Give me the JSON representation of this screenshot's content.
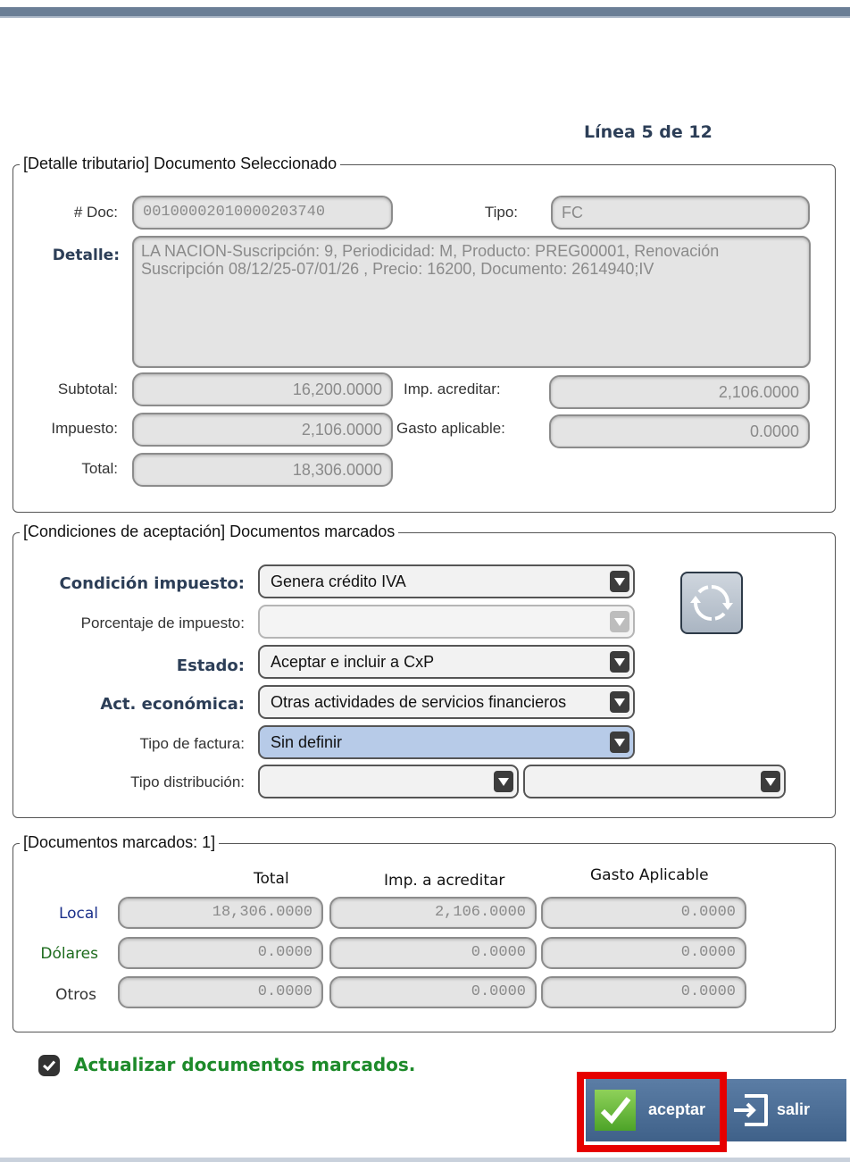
{
  "header": {
    "line_counter": "Línea 5 de 12"
  },
  "detalle_tributario": {
    "legend": "[Detalle tributario] Documento Seleccionado",
    "doc_label": "# Doc:",
    "doc_value": "00100002010000203740",
    "tipo_label": "Tipo:",
    "tipo_value": "FC",
    "detalle_label": "Detalle:",
    "detalle_value": "LA NACION-Suscripción: 9, Periodicidad: M, Producto: PREG00001, Renovación Suscripción 08/12/25-07/01/26  , Precio: 16200, Documento: 2614940;IV",
    "subtotal_label": "Subtotal:",
    "subtotal_value": "16,200.0000",
    "impuesto_label": "Impuesto:",
    "impuesto_value": "2,106.0000",
    "total_label": "Total:",
    "total_value": "18,306.0000",
    "imp_acreditar_label": "Imp. acreditar:",
    "imp_acreditar_value": "2,106.0000",
    "gasto_aplicable_label": "Gasto aplicable:",
    "gasto_aplicable_value": "0.0000"
  },
  "condiciones": {
    "legend": "[Condiciones de aceptación] Documentos marcados",
    "condicion_impuesto_label": "Condición impuesto:",
    "condicion_impuesto_value": "Genera crédito IVA",
    "porcentaje_label": "Porcentaje de impuesto:",
    "porcentaje_value": "",
    "estado_label": "Estado:",
    "estado_value": "Aceptar e incluir a CxP",
    "act_economica_label": "Act. económica:",
    "act_economica_value": "Otras actividades de servicios financieros",
    "tipo_factura_label": "Tipo de factura:",
    "tipo_factura_value": "Sin definir",
    "tipo_distribucion_label": "Tipo distribución:",
    "tipo_distribucion_value_1": "",
    "tipo_distribucion_value_2": ""
  },
  "marcados": {
    "legend": "[Documentos marcados: 1]",
    "headers": [
      "Total",
      "Imp. a acreditar",
      "Gasto Aplicable"
    ],
    "rows": [
      {
        "label": "Local",
        "color": "#1a2f8a",
        "values": [
          "18,306.0000",
          "2,106.0000",
          "0.0000"
        ]
      },
      {
        "label": "Dólares",
        "color": "#1d6b1d",
        "values": [
          "0.0000",
          "0.0000",
          "0.0000"
        ]
      },
      {
        "label": "Otros",
        "color": "#333333",
        "values": [
          "0.0000",
          "0.0000",
          "0.0000"
        ]
      }
    ]
  },
  "footer": {
    "actualizar_label": "Actualizar documentos marcados.",
    "actualizar_checked": true,
    "accept_label": "aceptar",
    "exit_label": "salir"
  },
  "colors": {
    "accent_green": "#1d8a2a",
    "highlight_red": "#e60000",
    "button_blue": "#4a6c96"
  }
}
